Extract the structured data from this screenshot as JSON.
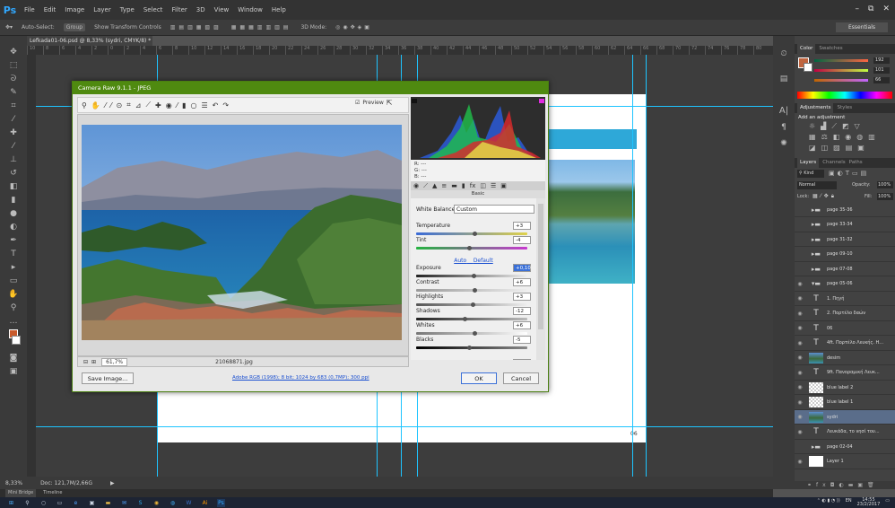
{
  "app": {
    "logo": "Ps",
    "menu": [
      "File",
      "Edit",
      "Image",
      "Layer",
      "Type",
      "Select",
      "Filter",
      "3D",
      "View",
      "Window",
      "Help"
    ],
    "window_controls": [
      "–",
      "⧉",
      "✕"
    ]
  },
  "options_bar": {
    "auto_select": "Auto-Select:",
    "auto_select_value": "Group",
    "transform": "Show Transform Controls",
    "mode_3d": "3D Mode:",
    "workspace": "Essentials"
  },
  "document": {
    "tab_title": "Lefkada01-06.psd @ 8,33% (sydri, CMYK/8) * ×",
    "ruler_ticks": [
      "10",
      "8",
      "6",
      "4",
      "2",
      "0",
      "2",
      "4",
      "6",
      "8",
      "10",
      "12",
      "14",
      "16",
      "18",
      "20",
      "22",
      "24",
      "26",
      "28",
      "30",
      "32",
      "34",
      "36",
      "38",
      "40",
      "42",
      "44",
      "46",
      "48",
      "50",
      "52",
      "54",
      "56",
      "58",
      "60",
      "62",
      "64",
      "66",
      "68",
      "70",
      "72",
      "74",
      "76",
      "78",
      "80",
      "82",
      "84",
      "86",
      "88",
      "90",
      "92",
      "94",
      "96",
      "98",
      "100",
      "102"
    ],
    "page_number": "06"
  },
  "status": {
    "zoom": "8,33%",
    "doc_size": "Doc: 121,7M/2,66G",
    "arrow": "▶"
  },
  "bottom_tabs": [
    "Mini Bridge",
    "Timeline"
  ],
  "camera_raw": {
    "title": "Camera Raw 9.1.1 - JPEG",
    "preview_label": "Preview",
    "zoom": "61,7%",
    "filename": "21068871.jpg",
    "rgb": {
      "r": "R:  ---",
      "g": "G:  ---",
      "b": "B:  ---"
    },
    "panel_title": "Basic",
    "white_balance_label": "White Balance:",
    "white_balance_value": "Custom",
    "auto": "Auto",
    "default": "Default",
    "sliders": [
      {
        "label": "Temperature",
        "value": "+3",
        "level": 0.53
      },
      {
        "label": "Tint",
        "value": "-4",
        "level": 0.48
      },
      {
        "label": "Exposure",
        "value": "+0,10",
        "level": 0.52
      },
      {
        "label": "Contrast",
        "value": "+6",
        "level": 0.53
      },
      {
        "label": "Highlights",
        "value": "+3",
        "level": 0.51
      },
      {
        "label": "Shadows",
        "value": "-12",
        "level": 0.44
      },
      {
        "label": "Whites",
        "value": "+6",
        "level": 0.53
      },
      {
        "label": "Blacks",
        "value": "-5",
        "level": 0.48
      },
      {
        "label": "Clarity",
        "value": "+10",
        "level": 0.55
      }
    ],
    "save_button": "Save Image...",
    "info_link": "Adobe RGB (1998); 8 bit; 1024 by 683 (0,7MP); 300 ppi",
    "ok_button": "OK",
    "cancel_button": "Cancel"
  },
  "color_panel": {
    "tabs": [
      "Color",
      "Swatches"
    ],
    "values": [
      "192",
      "101",
      "66"
    ],
    "fg_color": "#c0653f"
  },
  "adjustments_panel": {
    "tabs": [
      "Adjustments",
      "Styles"
    ],
    "heading": "Add an adjustment"
  },
  "layers_panel": {
    "tabs": [
      "Layers",
      "Channels",
      "Paths"
    ],
    "kind": "Kind",
    "blend_mode": "Normal",
    "opacity_label": "Opacity:",
    "opacity": "100%",
    "lock_label": "Lock:",
    "fill_label": "Fill:",
    "fill": "100%",
    "layers": [
      {
        "name": "page 35-36",
        "kind": "folder",
        "visible": false
      },
      {
        "name": "page 33-34",
        "kind": "folder",
        "visible": false
      },
      {
        "name": "page 31-32",
        "kind": "folder",
        "visible": false
      },
      {
        "name": "page 09-10",
        "kind": "folder",
        "visible": false
      },
      {
        "name": "page 07-08",
        "kind": "folder",
        "visible": false
      },
      {
        "name": "page 05-06",
        "kind": "folder-open",
        "visible": true
      },
      {
        "name": "1. Πηγή",
        "kind": "text",
        "visible": true
      },
      {
        "name": "2. Πορτέλο δαών",
        "kind": "text",
        "visible": true
      },
      {
        "name": "06",
        "kind": "text",
        "visible": true
      },
      {
        "name": "4ft. Πορτέλο Λευκής. Η...",
        "kind": "text",
        "visible": true
      },
      {
        "name": "desim",
        "kind": "pic",
        "visible": true
      },
      {
        "name": "9ft. Πανοραμική Λευκ...",
        "kind": "text",
        "visible": true
      },
      {
        "name": "blue label 2",
        "kind": "check",
        "visible": true
      },
      {
        "name": "blue label 1",
        "kind": "check",
        "visible": true
      },
      {
        "name": "sydri",
        "kind": "pic",
        "visible": true,
        "selected": true
      },
      {
        "name": "Λευκάδα, το νησί του...",
        "kind": "text",
        "visible": true
      },
      {
        "name": "page 02-04",
        "kind": "folder",
        "visible": false
      },
      {
        "name": "Layer 1",
        "kind": "white",
        "visible": true
      }
    ]
  },
  "taskbar": {
    "time": "14:55",
    "date": "23/2/2017",
    "lang": "EN"
  }
}
